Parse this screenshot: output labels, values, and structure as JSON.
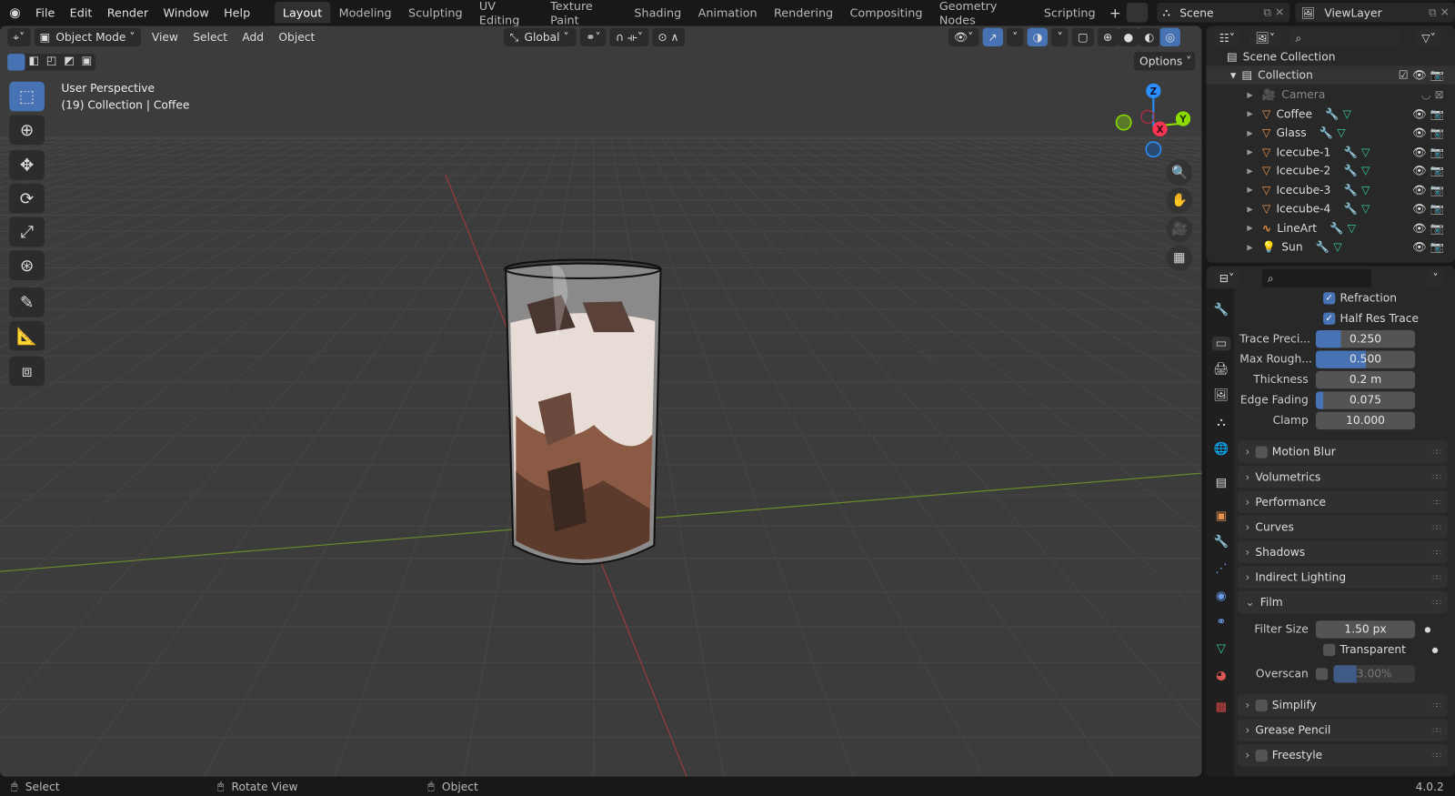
{
  "topbar": {
    "menus": [
      "File",
      "Edit",
      "Render",
      "Window",
      "Help"
    ],
    "workspaces": [
      "Layout",
      "Modeling",
      "Sculpting",
      "UV Editing",
      "Texture Paint",
      "Shading",
      "Animation",
      "Rendering",
      "Compositing",
      "Geometry Nodes",
      "Scripting"
    ],
    "active_workspace": "Layout",
    "scene": "Scene",
    "view_layer": "ViewLayer"
  },
  "viewport": {
    "mode": "Object Mode",
    "menus": [
      "View",
      "Select",
      "Add",
      "Object"
    ],
    "orientation": "Global",
    "options": "Options",
    "overlay_title": "User Perspective",
    "overlay_subtitle": "(19) Collection | Coffee",
    "gizmo": {
      "x": "X",
      "y": "Y",
      "z": "Z"
    }
  },
  "outliner": {
    "root": "Scene Collection",
    "collection": "Collection",
    "items": [
      {
        "name": "Camera",
        "icon": "camera-icon",
        "dim": true
      },
      {
        "name": "Coffee",
        "icon": "mesh-icon"
      },
      {
        "name": "Glass",
        "icon": "mesh-icon"
      },
      {
        "name": "Icecube-1",
        "icon": "mesh-icon"
      },
      {
        "name": "Icecube-2",
        "icon": "mesh-icon"
      },
      {
        "name": "Icecube-3",
        "icon": "mesh-icon"
      },
      {
        "name": "Icecube-4",
        "icon": "mesh-icon"
      },
      {
        "name": "LineArt",
        "icon": "grease-pencil-icon"
      },
      {
        "name": "Sun",
        "icon": "light-icon"
      }
    ]
  },
  "properties": {
    "refraction": "Refraction",
    "half_res_trace": "Half Res Trace",
    "fields": [
      {
        "label": "Trace Preci...",
        "value": "0.250",
        "fill": 0.25
      },
      {
        "label": "Max Rough...",
        "value": "0.500",
        "fill": 0.5
      },
      {
        "label": "Thickness",
        "value": "0.2 m",
        "fill": 0
      },
      {
        "label": "Edge Fading",
        "value": "0.075",
        "fill": 0.075
      },
      {
        "label": "Clamp",
        "value": "10.000",
        "fill": 0
      }
    ],
    "panels": [
      "Motion Blur",
      "Volumetrics",
      "Performance",
      "Curves",
      "Shadows",
      "Indirect Lighting",
      "Film"
    ],
    "film": {
      "filter_size_label": "Filter Size",
      "filter_size": "1.50 px",
      "transparent": "Transparent",
      "overscan_label": "Overscan",
      "overscan": "3.00%"
    },
    "panels_after": [
      "Simplify",
      "Grease Pencil",
      "Freestyle"
    ]
  },
  "status": {
    "select": "Select",
    "rotate": "Rotate View",
    "object": "Object",
    "version": "4.0.2"
  },
  "colors": {
    "accent": "#4772b3",
    "x_axis": "#ff3352",
    "y_axis": "#8bdc00",
    "z_axis": "#2890ff",
    "mesh": "#e8914a"
  }
}
